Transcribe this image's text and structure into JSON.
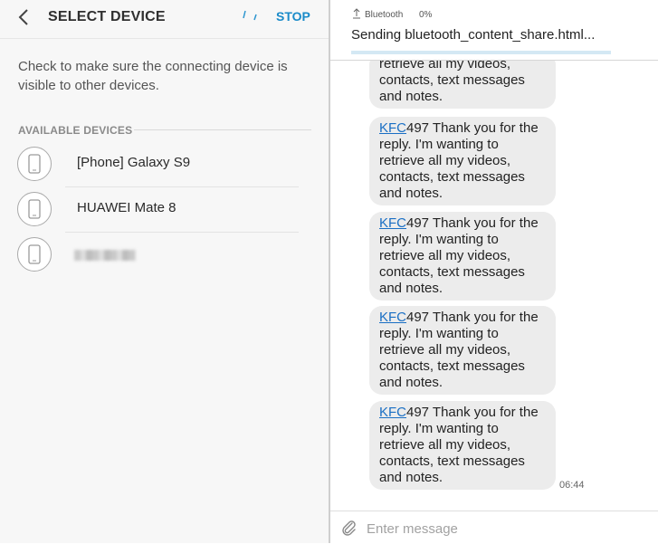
{
  "left_panel": {
    "title": "SELECT DEVICE",
    "stop_label": "STOP",
    "info_text": "Check to make sure the connecting device is visible to other devices.",
    "section_label": "AVAILABLE DEVICES",
    "devices": [
      {
        "name": "[Phone] Galaxy S9",
        "icon": "phone-icon"
      },
      {
        "name": "HUAWEI Mate 8",
        "icon": "phone-icon"
      },
      {
        "name": "",
        "icon": "phone-icon",
        "name_obscured": true
      }
    ]
  },
  "right_panel": {
    "notification": {
      "app_name": "Bluetooth",
      "percent_text": "0%",
      "sending_text": "Sending bluetooth_content_share.html...",
      "progress": 0.0
    },
    "messages": {
      "partial_first": "retrieve all my videos, contacts, text messages and notes.",
      "link_text": "KFC",
      "body_text": "497 Thank you for the reply. I'm wanting to retrieve all my videos, contacts, text messages and notes.",
      "timestamp": "06:44"
    },
    "composer": {
      "placeholder": "Enter message"
    }
  },
  "colors": {
    "accent": "#1a8bc9",
    "link": "#1a6fc4",
    "bubble": "#ececec",
    "progress": "#3aa0d8"
  }
}
